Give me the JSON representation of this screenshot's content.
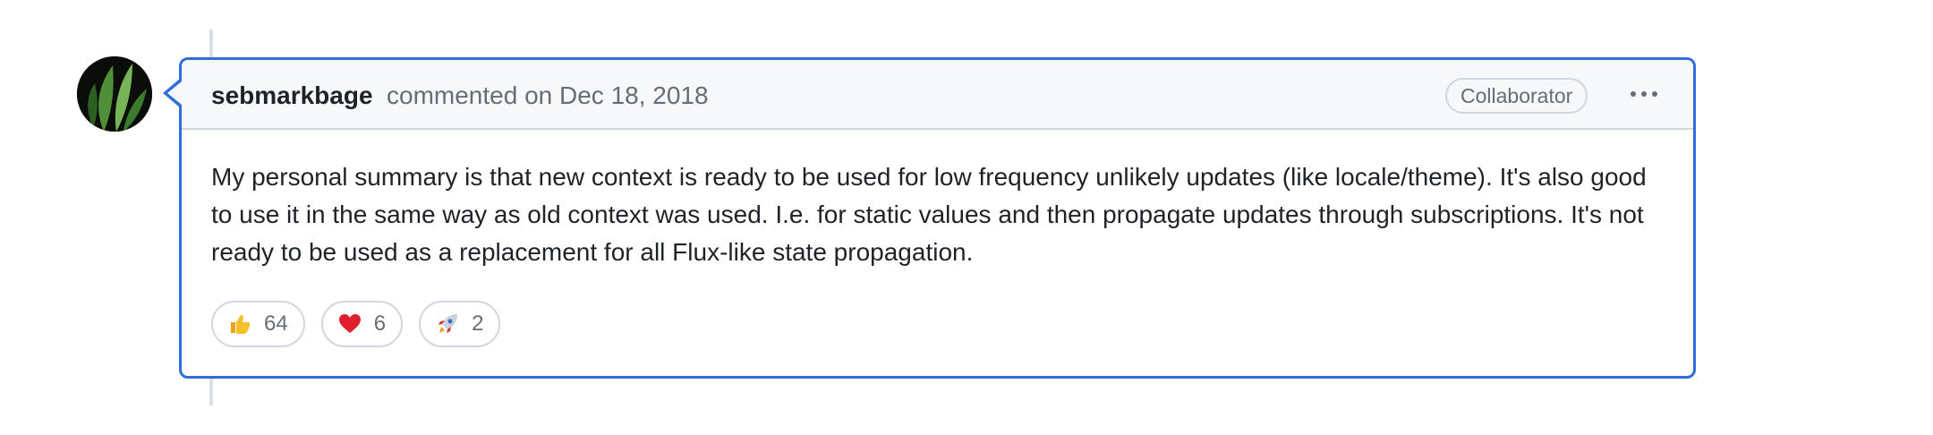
{
  "comment": {
    "author": "sebmarkbage",
    "meta": "commented on Dec 18, 2018",
    "role_badge": "Collaborator",
    "body": "My personal summary is that new context is ready to be used for low frequency unlikely updates (like locale/theme). It's also good to use it in the same way as old context was used. I.e. for static values and then propagate updates through subscriptions. It's not ready to be used as a replacement for all Flux-like state propagation."
  },
  "reactions": [
    {
      "icon": "thumbs-up-icon",
      "count": "64"
    },
    {
      "icon": "heart-icon",
      "count": "6"
    },
    {
      "icon": "rocket-icon",
      "count": "2"
    }
  ],
  "colors": {
    "accent_border": "#2f6ed8",
    "header_bg": "#f6f8fa",
    "muted_text": "#656d76",
    "border": "#d0d7de"
  }
}
